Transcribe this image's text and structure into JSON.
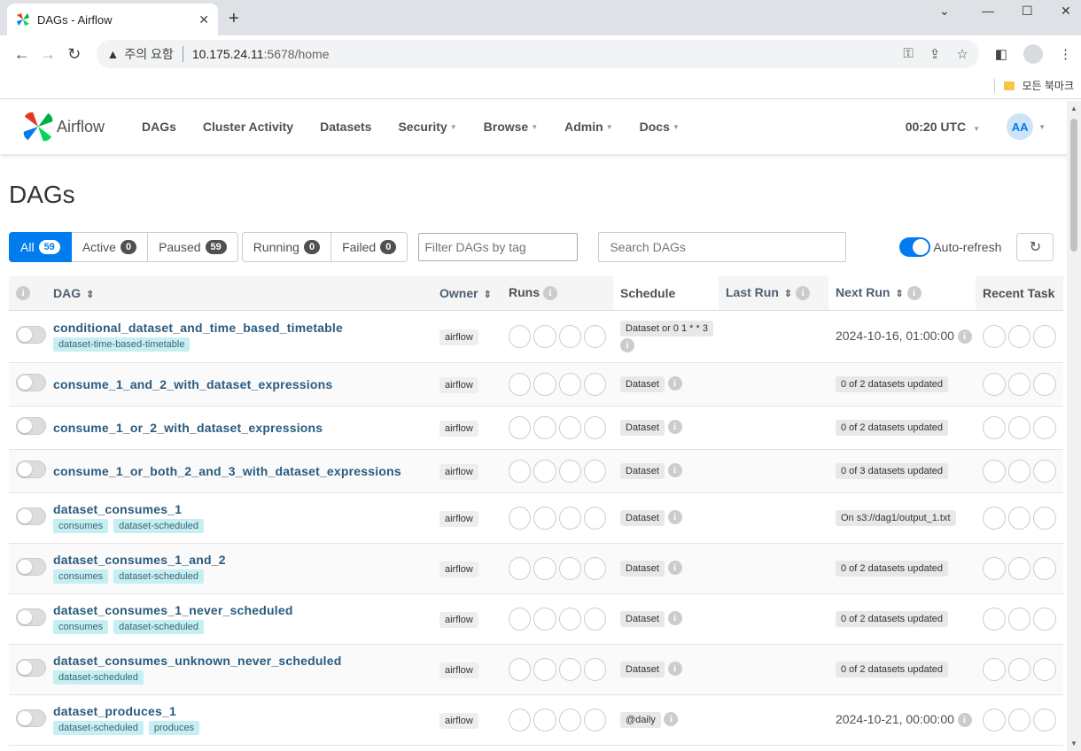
{
  "browser": {
    "tab_title": "DAGs - Airflow",
    "security_warning": "주의 요함",
    "url_host": "10.175.24.11",
    "url_rest": ":5678/home",
    "bookmarks_label": "모든 북마크"
  },
  "navbar": {
    "brand": "Airflow",
    "menu": [
      {
        "label": "DAGs",
        "dropdown": false
      },
      {
        "label": "Cluster Activity",
        "dropdown": false
      },
      {
        "label": "Datasets",
        "dropdown": false
      },
      {
        "label": "Security",
        "dropdown": true
      },
      {
        "label": "Browse",
        "dropdown": true
      },
      {
        "label": "Admin",
        "dropdown": true
      },
      {
        "label": "Docs",
        "dropdown": true
      }
    ],
    "clock": "00:20 UTC",
    "user_initials": "AA"
  },
  "page": {
    "title": "DAGs",
    "filters": {
      "all": {
        "label": "All",
        "count": "59"
      },
      "active": {
        "label": "Active",
        "count": "0"
      },
      "paused": {
        "label": "Paused",
        "count": "59"
      },
      "running": {
        "label": "Running",
        "count": "0"
      },
      "failed": {
        "label": "Failed",
        "count": "0"
      }
    },
    "tag_filter_placeholder": "Filter DAGs by tag",
    "search_placeholder": "Search DAGs",
    "auto_refresh_label": "Auto-refresh"
  },
  "table": {
    "headers": {
      "dag": "DAG",
      "owner": "Owner",
      "runs": "Runs",
      "schedule": "Schedule",
      "last_run": "Last Run",
      "next_run": "Next Run",
      "recent_tasks": "Recent Task"
    },
    "rows": [
      {
        "name": "conditional_dataset_and_time_based_timetable",
        "tags": [
          "dataset-time-based-timetable"
        ],
        "owner": "airflow",
        "schedule": "Dataset or 0 1 * * 3",
        "next_run": "2024-10-16, 01:00:00",
        "next_type": "text"
      },
      {
        "name": "consume_1_and_2_with_dataset_expressions",
        "tags": [],
        "owner": "airflow",
        "schedule": "Dataset",
        "next_run": "0 of 2 datasets updated",
        "next_type": "pill"
      },
      {
        "name": "consume_1_or_2_with_dataset_expressions",
        "tags": [],
        "owner": "airflow",
        "schedule": "Dataset",
        "next_run": "0 of 2 datasets updated",
        "next_type": "pill"
      },
      {
        "name": "consume_1_or_both_2_and_3_with_dataset_expressions",
        "tags": [],
        "owner": "airflow",
        "schedule": "Dataset",
        "next_run": "0 of 3 datasets updated",
        "next_type": "pill"
      },
      {
        "name": "dataset_consumes_1",
        "tags": [
          "consumes",
          "dataset-scheduled"
        ],
        "owner": "airflow",
        "schedule": "Dataset",
        "next_run": "On s3://dag1/output_1.txt",
        "next_type": "pill"
      },
      {
        "name": "dataset_consumes_1_and_2",
        "tags": [
          "consumes",
          "dataset-scheduled"
        ],
        "owner": "airflow",
        "schedule": "Dataset",
        "next_run": "0 of 2 datasets updated",
        "next_type": "pill"
      },
      {
        "name": "dataset_consumes_1_never_scheduled",
        "tags": [
          "consumes",
          "dataset-scheduled"
        ],
        "owner": "airflow",
        "schedule": "Dataset",
        "next_run": "0 of 2 datasets updated",
        "next_type": "pill"
      },
      {
        "name": "dataset_consumes_unknown_never_scheduled",
        "tags": [
          "dataset-scheduled"
        ],
        "owner": "airflow",
        "schedule": "Dataset",
        "next_run": "0 of 2 datasets updated",
        "next_type": "pill"
      },
      {
        "name": "dataset_produces_1",
        "tags": [
          "dataset-scheduled",
          "produces"
        ],
        "owner": "airflow",
        "schedule": "@daily",
        "next_run": "2024-10-21, 00:00:00",
        "next_type": "text"
      }
    ]
  },
  "colors": {
    "accent": "#017cee",
    "tag_bg": "#c5eff2",
    "dag_link": "#2a5b7f"
  }
}
